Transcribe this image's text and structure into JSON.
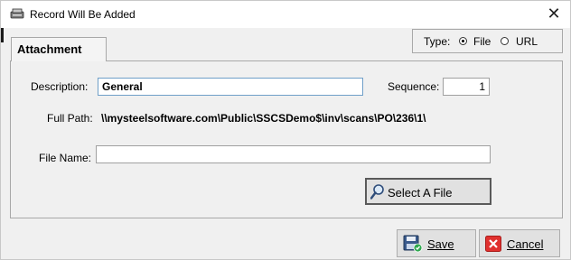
{
  "window": {
    "title": "Record Will Be Added",
    "close_symbol": "✕",
    "title_icon": "scanner-icon"
  },
  "tabs": [
    {
      "label": "Attachment",
      "active": true
    }
  ],
  "type_selector": {
    "label": "Type:",
    "options": [
      {
        "label": "File",
        "checked": true
      },
      {
        "label": "URL",
        "checked": false
      }
    ]
  },
  "form": {
    "description_label": "Description:",
    "description_value": "General",
    "sequence_label": "Sequence:",
    "sequence_value": "1",
    "full_path_label": "Full Path:",
    "full_path_value": "\\\\mysteelsoftware.com\\Public\\SSCSDemo$\\inv\\scans\\PO\\236\\1\\",
    "file_name_label": "File Name:",
    "file_name_value": ""
  },
  "buttons": {
    "select_file": {
      "label": "Select A File",
      "icon": "magnifier-icon"
    },
    "save": {
      "label": "Save",
      "icon": "floppy-disk-icon"
    },
    "cancel": {
      "label": "Cancel",
      "icon": "red-x-icon"
    }
  },
  "colors": {
    "cancel_icon": "#e0312f",
    "save_icon_check": "#2fa84f",
    "focus_border": "#3c7fb1"
  }
}
